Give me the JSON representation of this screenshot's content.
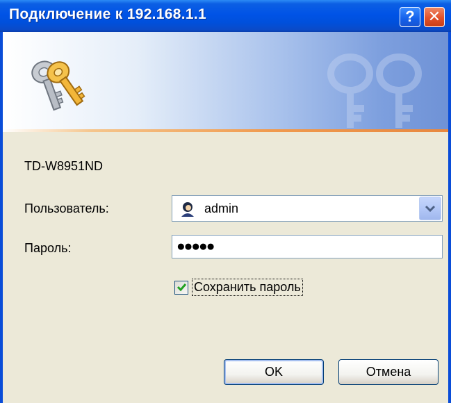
{
  "window": {
    "title": "Подключение к 192.168.1.1",
    "help_button": "?",
    "close_button": "✕"
  },
  "banner": {
    "icon": "keys-icon",
    "watermark": "keys-watermark"
  },
  "form": {
    "device_name": "TD-W8951ND",
    "user_label": "Пользователь:",
    "user_value": "admin",
    "user_icon": "user-icon",
    "password_label": "Пароль:",
    "password_value": "●●●●●",
    "remember_label": "Сохранить пароль",
    "remember_checked": true
  },
  "buttons": {
    "ok": "OK",
    "cancel": "Отмена"
  },
  "colors": {
    "titlebar": "#0053E6",
    "dialog_bg": "#ECE9D8",
    "accent_line": "#F09A4E"
  }
}
